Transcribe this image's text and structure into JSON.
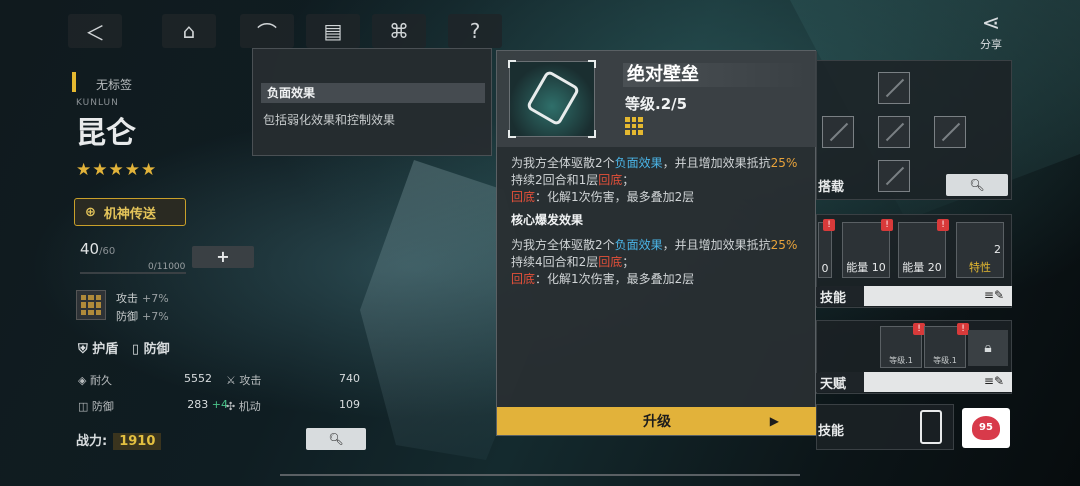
{
  "top": {
    "share_label": "分享"
  },
  "character": {
    "tag": "无标签",
    "code": "KUNLUN",
    "name": "昆仑",
    "stars": "★★★★★",
    "teleport_label": "机神传送",
    "level": "40",
    "level_max": "/60",
    "exp": "0/11000",
    "plus_label": "+",
    "buffs": [
      {
        "label": "攻击",
        "value": "+7%"
      },
      {
        "label": "防御",
        "value": "+7%"
      }
    ],
    "roles": [
      "护盾",
      "防御"
    ],
    "stats": [
      {
        "label": "耐久",
        "value": "5552"
      },
      {
        "label": "攻击",
        "value": "740"
      },
      {
        "label": "防御",
        "value": "283",
        "bonus": "+4"
      },
      {
        "label": "机动",
        "value": "109"
      }
    ],
    "power_label": "战力:",
    "power_value": "1910"
  },
  "tooltip": {
    "title": "负面效果",
    "text": "包括弱化效果和控制效果"
  },
  "skill": {
    "name": "绝对壁垒",
    "level": "等级.2/5",
    "desc1_a": "为我方全体驱散2个",
    "desc1_neg": "负面效果",
    "desc1_b": "，并且增加效果抵抗",
    "desc1_pct": "25%",
    "desc1_c": "持续2回合和1层",
    "desc1_fallback": "回底",
    "desc1_d": "；",
    "desc2_label": "回底",
    "desc2_text": "：化解1次伤害，最多叠加2层",
    "core_title": "核心爆发效果",
    "desc3_a": "为我方全体驱散2个",
    "desc3_neg": "负面效果",
    "desc3_b": "，并且增加效果抵抗",
    "desc3_pct": "25%",
    "desc3_c": "持续4回合和2层",
    "desc3_fallback": "回底",
    "desc3_d": "；",
    "desc4_label": "回底",
    "desc4_text": "：化解1次伤害，最多叠加2层",
    "upgrade_label": "升级"
  },
  "right": {
    "load_label": "搭载",
    "cards": [
      {
        "cap": "0"
      },
      {
        "cap": "能量 10"
      },
      {
        "cap": "能量 20"
      },
      {
        "cap": "特性"
      }
    ],
    "card4_level": "2",
    "skill_bar_label": "技能",
    "talent_levels": [
      "等级.1",
      "等级.1"
    ],
    "talent_bar_label": "天赋",
    "skill2_label": "技能",
    "heart_value": "95"
  }
}
